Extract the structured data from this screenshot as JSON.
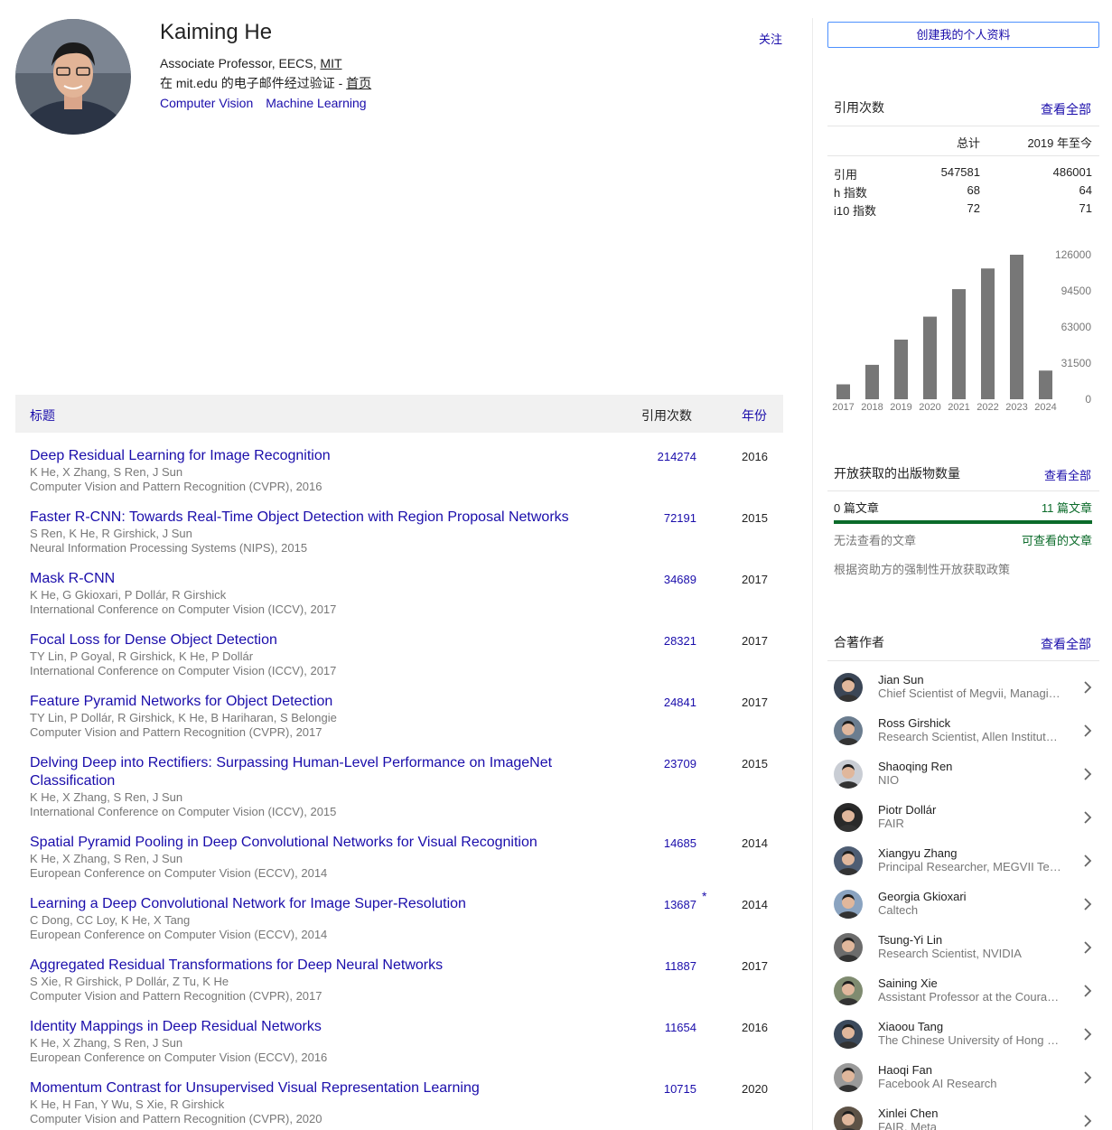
{
  "profile": {
    "name": "Kaiming He",
    "affiliation_prefix": "Associate Professor, EECS, ",
    "affiliation_link": "MIT",
    "email_text": "在 mit.edu 的电子邮件经过验证 - ",
    "homepage_link": "首页",
    "interests": [
      "Computer Vision",
      "Machine Learning"
    ],
    "follow_label": "关注"
  },
  "sidebar": {
    "create_profile_label": "创建我的个人资料",
    "citations": {
      "title": "引用次数",
      "view_all": "查看全部",
      "col_total": "总计",
      "col_since": "2019 年至今",
      "rows": [
        {
          "label": "引用",
          "total": "547581",
          "since": "486001"
        },
        {
          "label": "h 指数",
          "total": "68",
          "since": "64"
        },
        {
          "label": "i10 指数",
          "total": "72",
          "since": "71"
        }
      ]
    },
    "open_access": {
      "title": "开放获取的出版物数量",
      "view_all": "查看全部",
      "left_count": "0 篇文章",
      "right_count": "11 篇文章",
      "left_label": "无法查看的文章",
      "right_label": "可查看的文章",
      "policy": "根据资助方的强制性开放获取政策"
    },
    "coauthors": {
      "title": "合著作者",
      "view_all": "查看全部",
      "items": [
        {
          "name": "Jian Sun",
          "desc": "Chief Scientist of Megvii, Managing Director of Megvii Research"
        },
        {
          "name": "Ross Girshick",
          "desc": "Research Scientist, Allen Institute for AI"
        },
        {
          "name": "Shaoqing Ren",
          "desc": "NIO"
        },
        {
          "name": "Piotr Dollár",
          "desc": "FAIR"
        },
        {
          "name": "Xiangyu Zhang",
          "desc": "Principal Researcher, MEGVII Technology"
        },
        {
          "name": "Georgia Gkioxari",
          "desc": "Caltech"
        },
        {
          "name": "Tsung-Yi Lin",
          "desc": "Research Scientist, NVIDIA"
        },
        {
          "name": "Saining Xie",
          "desc": "Assistant Professor at the Courant Institute"
        },
        {
          "name": "Xiaoou Tang",
          "desc": "The Chinese University of Hong Kong"
        },
        {
          "name": "Haoqi Fan",
          "desc": "Facebook AI Research"
        },
        {
          "name": "Xinlei Chen",
          "desc": "FAIR, Meta"
        }
      ]
    }
  },
  "chart_data": {
    "type": "bar",
    "categories": [
      "2017",
      "2018",
      "2019",
      "2020",
      "2021",
      "2022",
      "2023",
      "2024"
    ],
    "values": [
      13000,
      30000,
      52000,
      72000,
      96000,
      114000,
      126000,
      25000
    ],
    "title": "",
    "xlabel": "",
    "ylabel": "",
    "ylim": [
      0,
      126000
    ],
    "yticks": [
      "0",
      "31500",
      "63000",
      "94500",
      "126000"
    ],
    "ytick_values": [
      0,
      31500,
      63000,
      94500,
      126000
    ],
    "bar_color": "#777777",
    "grid": false,
    "legend": "none"
  },
  "table": {
    "col_title": "标题",
    "col_cites": "引用次数",
    "col_year": "年份",
    "rows": [
      {
        "title": "Deep Residual Learning for Image Recognition",
        "authors": "K He, X Zhang, S Ren, J Sun",
        "venue": "Computer Vision and Pattern Recognition (CVPR), 2016",
        "cites": "214274",
        "year": "2016",
        "star": ""
      },
      {
        "title": "Faster R-CNN: Towards Real-Time Object Detection with Region Proposal Networks",
        "authors": "S Ren, K He, R Girshick, J Sun",
        "venue": "Neural Information Processing Systems (NIPS), 2015",
        "cites": "72191",
        "year": "2015",
        "star": ""
      },
      {
        "title": "Mask R-CNN",
        "authors": "K He, G Gkioxari, P Dollár, R Girshick",
        "venue": "International Conference on Computer Vision (ICCV), 2017",
        "cites": "34689",
        "year": "2017",
        "star": ""
      },
      {
        "title": "Focal Loss for Dense Object Detection",
        "authors": "TY Lin, P Goyal, R Girshick, K He, P Dollár",
        "venue": "International Conference on Computer Vision (ICCV), 2017",
        "cites": "28321",
        "year": "2017",
        "star": ""
      },
      {
        "title": "Feature Pyramid Networks for Object Detection",
        "authors": "TY Lin, P Dollár, R Girshick, K He, B Hariharan, S Belongie",
        "venue": "Computer Vision and Pattern Recognition (CVPR), 2017",
        "cites": "24841",
        "year": "2017",
        "star": ""
      },
      {
        "title": "Delving Deep into Rectifiers: Surpassing Human-Level Performance on ImageNet Classification",
        "authors": "K He, X Zhang, S Ren, J Sun",
        "venue": "International Conference on Computer Vision (ICCV), 2015",
        "cites": "23709",
        "year": "2015",
        "star": ""
      },
      {
        "title": "Spatial Pyramid Pooling in Deep Convolutional Networks for Visual Recognition",
        "authors": "K He, X Zhang, S Ren, J Sun",
        "venue": "European Conference on Computer Vision (ECCV), 2014",
        "cites": "14685",
        "year": "2014",
        "star": ""
      },
      {
        "title": "Learning a Deep Convolutional Network for Image Super-Resolution",
        "authors": "C Dong, CC Loy, K He, X Tang",
        "venue": "European Conference on Computer Vision (ECCV), 2014",
        "cites": "13687",
        "year": "2014",
        "star": "*"
      },
      {
        "title": "Aggregated Residual Transformations for Deep Neural Networks",
        "authors": "S Xie, R Girshick, P Dollár, Z Tu, K He",
        "venue": "Computer Vision and Pattern Recognition (CVPR), 2017",
        "cites": "11887",
        "year": "2017",
        "star": ""
      },
      {
        "title": "Identity Mappings in Deep Residual Networks",
        "authors": "K He, X Zhang, S Ren, J Sun",
        "venue": "European Conference on Computer Vision (ECCV), 2016",
        "cites": "11654",
        "year": "2016",
        "star": ""
      },
      {
        "title": "Momentum Contrast for Unsupervised Visual Representation Learning",
        "authors": "K He, H Fan, Y Wu, S Xie, R Girshick",
        "venue": "Computer Vision and Pattern Recognition (CVPR), 2020",
        "cites": "10715",
        "year": "2020",
        "star": ""
      }
    ]
  }
}
